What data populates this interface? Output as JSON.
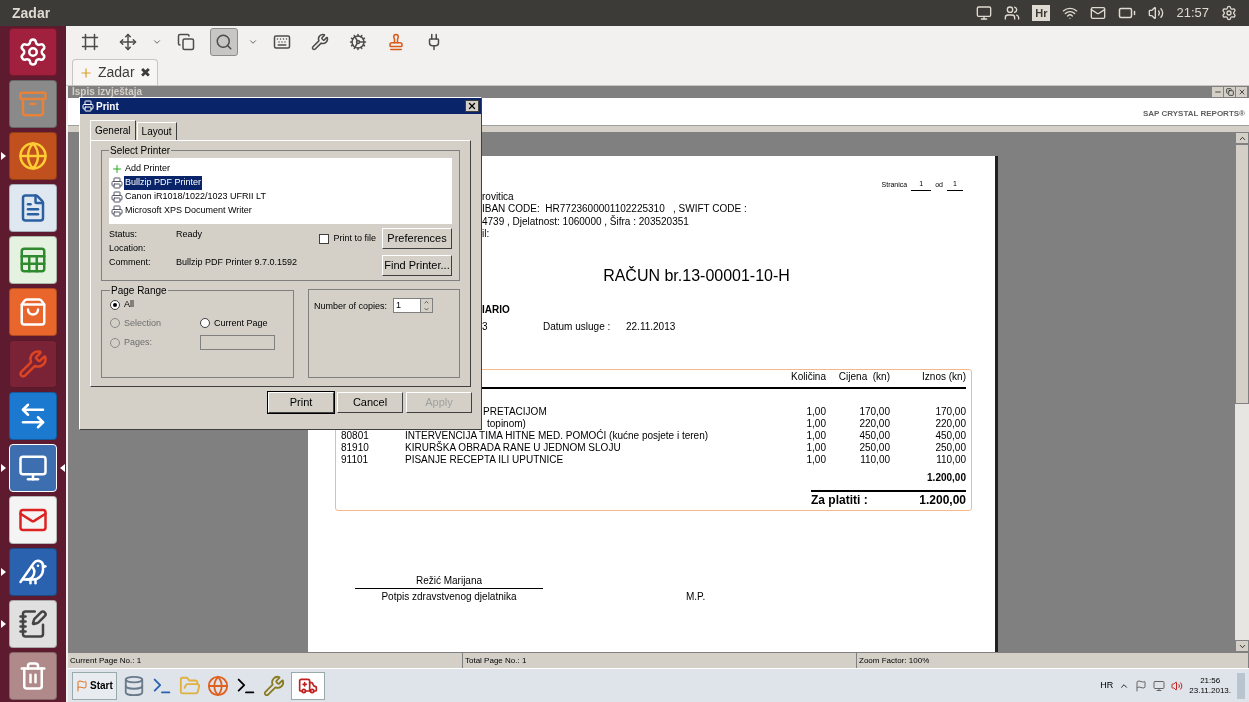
{
  "top_bar": {
    "title": "Zadar",
    "keyboard_layout": "Hr",
    "time": "21:57"
  },
  "launcher": [
    {
      "running": false,
      "focused": false
    },
    {
      "running": false,
      "focused": false
    },
    {
      "running": true,
      "focused": false
    },
    {
      "running": false,
      "focused": false
    },
    {
      "running": false,
      "focused": false
    },
    {
      "running": false,
      "focused": false
    },
    {
      "running": false,
      "focused": false
    },
    {
      "running": false,
      "focused": false
    },
    {
      "running": true,
      "focused": true
    },
    {
      "running": false,
      "focused": false
    },
    {
      "running": true,
      "focused": false
    },
    {
      "running": true,
      "focused": false
    },
    {
      "running": false,
      "focused": false
    }
  ],
  "toolbar": [
    {
      "selected": false
    },
    {
      "selected": false
    },
    {
      "selected": false
    },
    {
      "selected": true
    },
    {
      "selected": false
    },
    {
      "selected": false
    },
    {
      "selected": false
    },
    {
      "selected": false
    },
    {
      "selected": false
    }
  ],
  "tabs": [
    {
      "label": "Zadar",
      "close": "✖",
      "selected": true
    }
  ],
  "window": {
    "title": "Ispis izvještaja",
    "brand": "SAP CRYSTAL REPORTS®"
  },
  "report": {
    "page_label": "Stranica",
    "page": "1",
    "of_label": "od",
    "pages": "1",
    "header_lines": [
      "rovitica",
      "IBAN CODE:  HR7723600001102225310   , SWIFT CODE :",
      "4739 , Djelatnost: 1060000 , Šifra : 203520351",
      "il:"
    ],
    "title": "RAČUN br.13-00001-10-H",
    "patient": "IARIO",
    "patient_line": "3",
    "service_date_label": "Datum usluge :",
    "service_date": "22.11.2013",
    "columns": [
      "Količina",
      "Cijena  (kn)",
      "Iznos (kn)"
    ],
    "rows": [
      {
        "description": "PRETACIJOM",
        "quantity": "1,00",
        "price": "170,00",
        "amount": "170,00"
      },
      {
        "description": "topinom)",
        "quantity": "1,00",
        "price": "220,00",
        "amount": "220,00"
      },
      {
        "code": "80801",
        "description": "INTERVENCIJA TIMA HITNE MED. POMOĆI (kućne posjete i teren)",
        "quantity": "1,00",
        "price": "450,00",
        "amount": "450,00"
      },
      {
        "code": "81910",
        "description": "KIRURŠKA OBRADA RANE U JEDNOM SLOJU",
        "quantity": "1,00",
        "price": "250,00",
        "amount": "250,00"
      },
      {
        "code": "91101",
        "description": "PISANJE RECEPTA ILI UPUTNICE",
        "quantity": "1,00",
        "price": "110,00",
        "amount": "110,00"
      }
    ],
    "subtotal": "1.200,00",
    "total_label": "Za platiti :",
    "total": "1.200,00",
    "signer": "Režić Marijana",
    "signature_caption": "Potpis zdravstvenog djelatnika",
    "stamp": "M.P."
  },
  "print_dialog": {
    "title": "Print",
    "tabs": [
      {
        "label": "General",
        "selected": true
      },
      {
        "label": "Layout",
        "selected": false
      }
    ],
    "select_printer": "Select Printer",
    "printers": [
      {
        "name": "Add Printer",
        "selected": false,
        "kind": "add"
      },
      {
        "name": "Bullzip PDF Printer",
        "selected": true,
        "kind": "printer"
      },
      {
        "name": "Canon iR1018/1022/1023 UFRII LT",
        "selected": false,
        "kind": "printer"
      },
      {
        "name": "Microsoft XPS Document Writer",
        "selected": false,
        "kind": "printer"
      }
    ],
    "info": [
      {
        "label": "Status:",
        "value": "Ready"
      },
      {
        "label": "Location:"
      },
      {
        "label": "Comment:",
        "value": "Bullzip PDF Printer 9.7.0.1592"
      }
    ],
    "print_to_file": {
      "label": "Print to file",
      "checked": false
    },
    "preferences": "Preferences",
    "find_printer": "Find Printer...",
    "page_range": {
      "title": "Page Range",
      "options": [
        {
          "label": "All",
          "selected": true,
          "disabled": false
        },
        {
          "label": "Selection",
          "selected": false,
          "disabled": true
        },
        {
          "label": "Current Page",
          "selected": false,
          "disabled": false
        },
        {
          "label": "Pages:",
          "selected": false,
          "disabled": true
        }
      ]
    },
    "copies_label": "Number of copies:",
    "copies": "1",
    "buttons": [
      {
        "label": "Print",
        "disabled": false
      },
      {
        "label": "Cancel",
        "disabled": false
      },
      {
        "label": "Apply",
        "disabled": true
      }
    ]
  },
  "status_bar": [
    "Current Page No.: 1",
    "Total Page No.: 1",
    "Zoom Factor: 100%"
  ],
  "taskbar": {
    "start": "Start",
    "language": "HR",
    "time": "21:56",
    "date": "23.11.2013."
  }
}
